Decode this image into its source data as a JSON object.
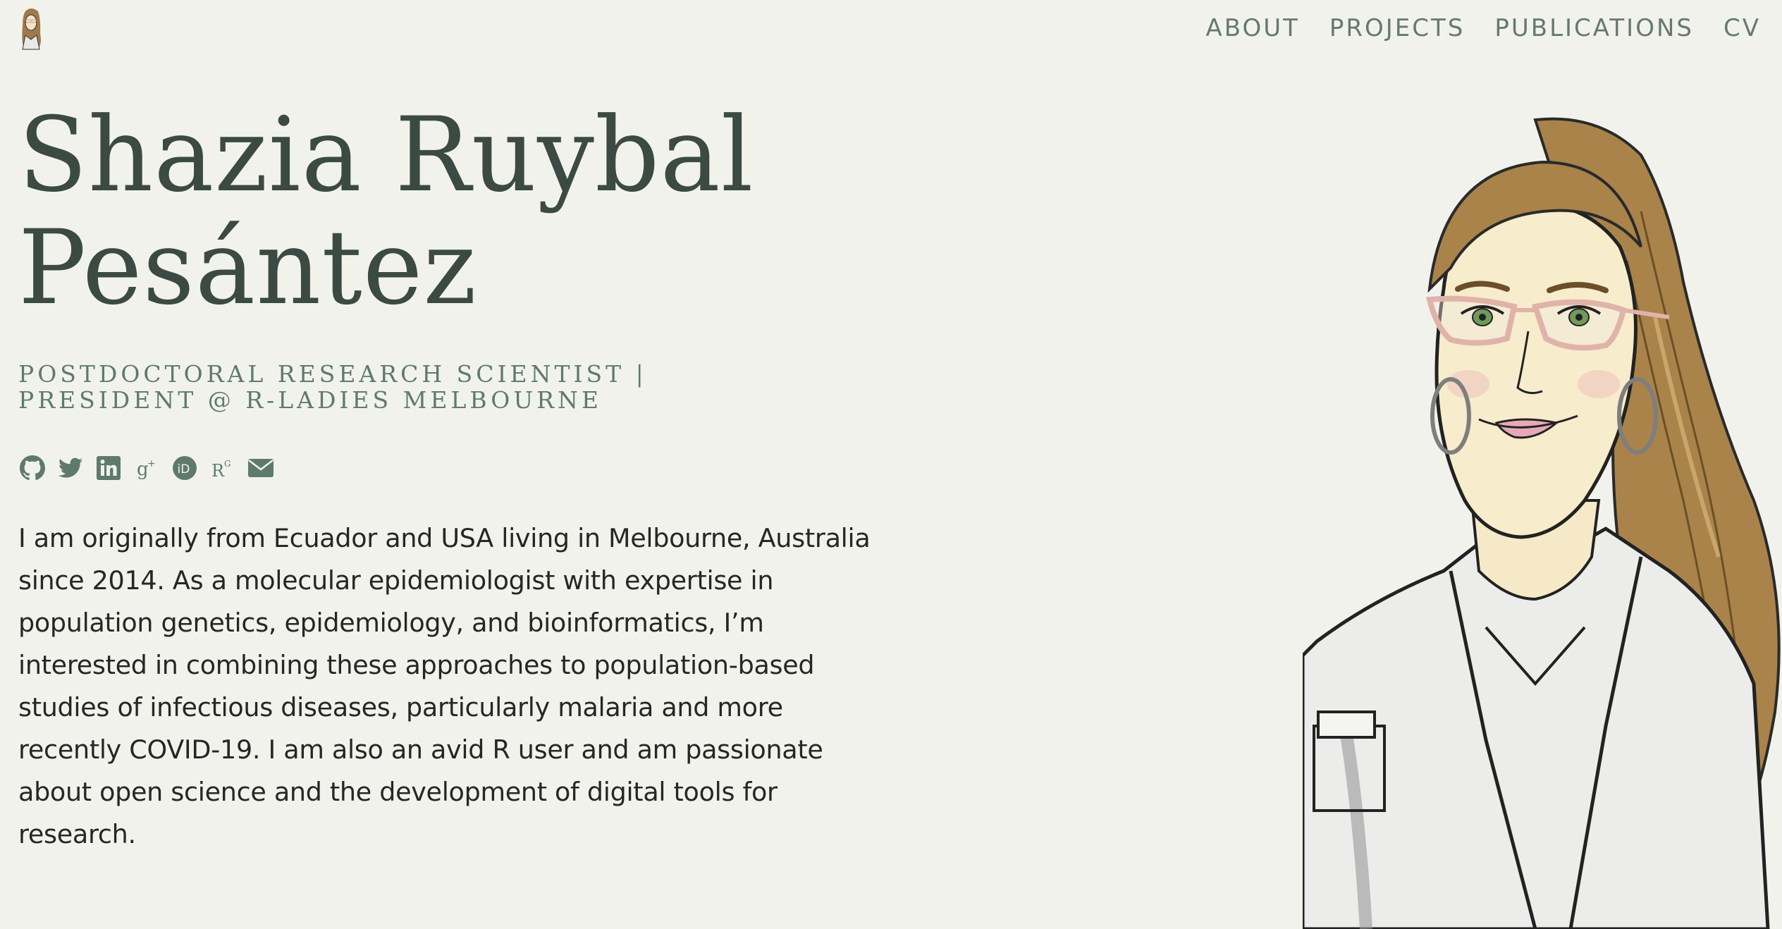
{
  "nav": {
    "items": [
      "ABOUT",
      "PROJECTS",
      "PUBLICATIONS",
      "CV"
    ]
  },
  "hero": {
    "name_line1": "Shazia Ruybal",
    "name_line2": "Pesántez",
    "subtitle": "POSTDOCTORAL RESEARCH SCIENTIST | PRESIDENT @ R-LADIES MELBOURNE",
    "bio": "I am originally from Ecuador and USA living in Melbourne, Australia since 2014. As a molecular epidemiologist with expertise in population genetics, epidemiology, and bioinformatics, I’m interested in combining these approaches to population-based studies of infectious diseases, particularly malaria and more recently COVID-19. I am also an avid R user and am passionate about open science and the development of digital tools for research."
  },
  "social_icons": [
    "github-icon",
    "twitter-icon",
    "linkedin-icon",
    "google-scholar-icon",
    "orcid-icon",
    "researchgate-icon",
    "email-icon"
  ],
  "colors": {
    "background": "#f2f2ed",
    "accent": "#5e7a6c",
    "heading": "#3b4a42",
    "text": "#262626"
  }
}
